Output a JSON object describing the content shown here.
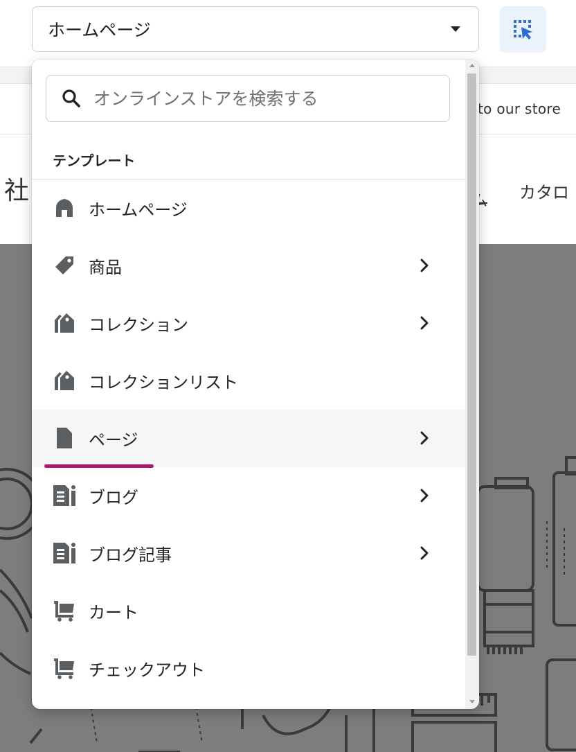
{
  "top_select": {
    "value": "ホームページ"
  },
  "preview": {
    "announcement": "to our store",
    "store_name": "社",
    "nav_stub": "ム",
    "nav_catalog": "カタロ"
  },
  "dropdown": {
    "search_placeholder": "オンラインストアを検索する",
    "section_label": "テンプレート",
    "items": [
      {
        "label": "ホームページ",
        "icon": "home-icon",
        "has_submenu": false
      },
      {
        "label": "商品",
        "icon": "tag-icon",
        "has_submenu": true
      },
      {
        "label": "コレクション",
        "icon": "collection-tags-icon",
        "has_submenu": true
      },
      {
        "label": "コレクションリスト",
        "icon": "collection-tags-icon",
        "has_submenu": false
      },
      {
        "label": "ページ",
        "icon": "page-icon",
        "has_submenu": true,
        "active": true
      },
      {
        "label": "ブログ",
        "icon": "blog-icon",
        "has_submenu": true
      },
      {
        "label": "ブログ記事",
        "icon": "blog-icon",
        "has_submenu": true
      },
      {
        "label": "カート",
        "icon": "cart-icon",
        "has_submenu": false
      },
      {
        "label": "チェックアウト",
        "icon": "cart-icon",
        "has_submenu": false
      }
    ]
  },
  "colors": {
    "accent": "#b0166d",
    "icon": "#5c5f62",
    "inspector_bg": "#eaf2fc",
    "inspector_icon": "#2c6ecb"
  }
}
